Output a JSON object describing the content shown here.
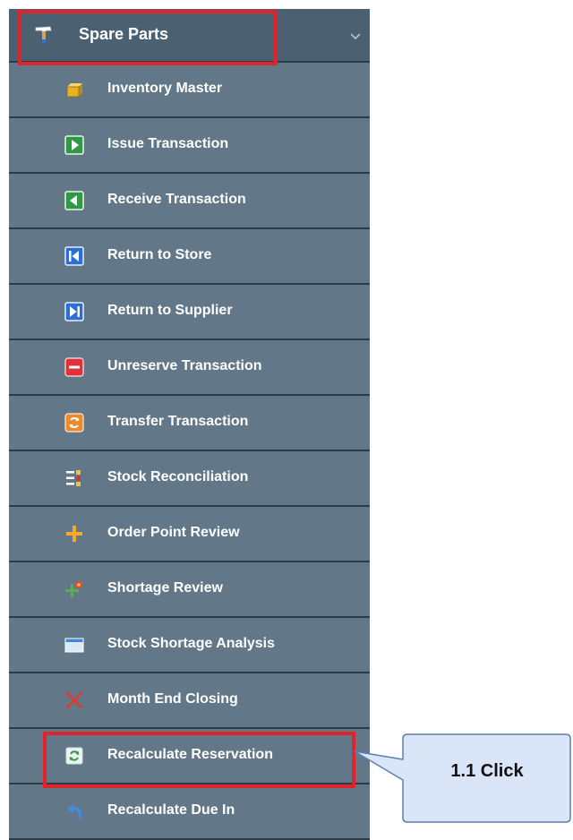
{
  "menu": {
    "header": {
      "label": "Spare Parts",
      "icon": "hammer-icon",
      "chevron": "chevron-down-icon"
    },
    "items": [
      {
        "label": "Inventory Master",
        "icon": "box-icon"
      },
      {
        "label": "Issue Transaction",
        "icon": "play-right-icon"
      },
      {
        "label": "Receive Transaction",
        "icon": "play-left-icon"
      },
      {
        "label": "Return to Store",
        "icon": "skip-back-icon"
      },
      {
        "label": "Return to Supplier",
        "icon": "skip-forward-icon"
      },
      {
        "label": "Unreserve Transaction",
        "icon": "minus-icon"
      },
      {
        "label": "Transfer Transaction",
        "icon": "transfer-icon"
      },
      {
        "label": "Stock Reconciliation",
        "icon": "reconcile-icon"
      },
      {
        "label": "Order Point Review",
        "icon": "plus-icon"
      },
      {
        "label": "Shortage Review",
        "icon": "shortage-icon"
      },
      {
        "label": "Stock Shortage Analysis",
        "icon": "window-icon"
      },
      {
        "label": "Month End Closing",
        "icon": "x-icon"
      },
      {
        "label": "Recalculate Reservation",
        "icon": "refresh-icon"
      },
      {
        "label": "Recalculate Due In",
        "icon": "undo-icon"
      }
    ]
  },
  "callout": {
    "text": "1.1 Click"
  },
  "colors": {
    "menu_bg": "#627889",
    "header_bg": "#4b6071",
    "highlight": "#e0242a",
    "callout_bg": "#dae6f7",
    "callout_border": "#5a7faa"
  }
}
